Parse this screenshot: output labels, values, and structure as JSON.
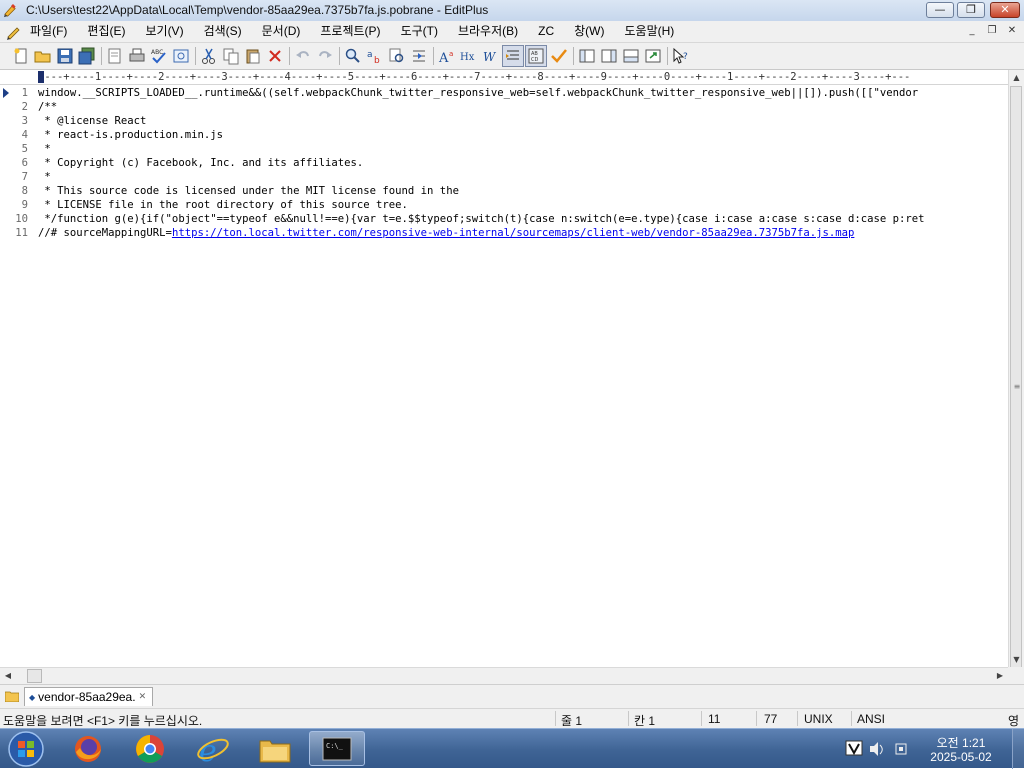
{
  "window": {
    "title": "C:\\Users\\test22\\AppData\\Local\\Temp\\vendor-85aa29ea.7375b7fa.js.pobrane - EditPlus",
    "min_glyph": "—",
    "max_glyph": "❐",
    "close_glyph": "✕"
  },
  "menu": {
    "items": [
      "파일(F)",
      "편집(E)",
      "보기(V)",
      "검색(S)",
      "문서(D)",
      "프로젝트(P)",
      "도구(T)",
      "브라우저(B)",
      "ZC",
      "창(W)",
      "도움말(H)"
    ],
    "mdi_min": "_",
    "mdi_restore": "❐",
    "mdi_close": "✕"
  },
  "ruler": {
    "text": "----+----1----+----2----+----3----+----4----+----5----+----6----+----7----+----8----+----9----+----0----+----1----+----2----+----3----+---"
  },
  "editor": {
    "lines": [
      {
        "n": "1",
        "text": "window.__SCRIPTS_LOADED__.runtime&&((self.webpackChunk_twitter_responsive_web=self.webpackChunk_twitter_responsive_web||[]).push([[\"vendor"
      },
      {
        "n": "2",
        "text": "/**"
      },
      {
        "n": "3",
        "text": " * @license React"
      },
      {
        "n": "4",
        "text": " * react-is.production.min.js"
      },
      {
        "n": "5",
        "text": " *"
      },
      {
        "n": "6",
        "text": " * Copyright (c) Facebook, Inc. and its affiliates."
      },
      {
        "n": "7",
        "text": " *"
      },
      {
        "n": "8",
        "text": " * This source code is licensed under the MIT license found in the"
      },
      {
        "n": "9",
        "text": " * LICENSE file in the root directory of this source tree."
      },
      {
        "n": "10",
        "text": " */function g(e){if(\"object\"==typeof e&&null!==e){var t=e.$$typeof;switch(t){case n:switch(e=e.type){case i:case a:case s:case d:case p:ret"
      },
      {
        "n": "11",
        "prefix": "//# sourceMappingURL=",
        "link": "https://ton.local.twitter.com/responsive-web-internal/sourcemaps/client-web/vendor-85aa29ea.7375b7fa.js.map"
      }
    ]
  },
  "doc_tabs": {
    "active": "vendor-85aa29ea.",
    "close_glyph": "✕"
  },
  "status": {
    "help": "도움말을 보려면 <F1> 키를 누르십시오.",
    "line": "줄 1",
    "col": "칸 1",
    "lines_total": "11",
    "chars": "77",
    "eol": "UNIX",
    "encoding": "ANSI",
    "ime": "영"
  },
  "taskbar": {
    "time": "오전 1:21",
    "date": "2025-05-02"
  },
  "colors": {
    "link": "#0000ee",
    "taskbar": "#3f6495"
  }
}
